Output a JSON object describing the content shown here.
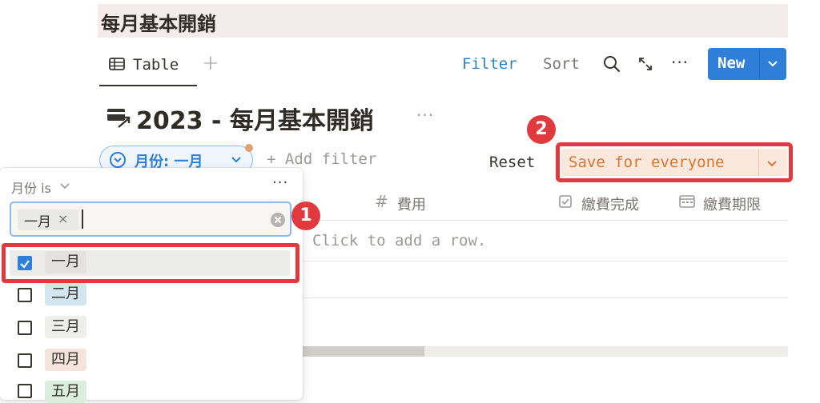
{
  "page": {
    "title": "每月基本開銷"
  },
  "view_tabs": [
    {
      "label": "Table",
      "icon": "table-icon",
      "active": true
    }
  ],
  "toolbar": {
    "add_view": "+",
    "filter": "Filter",
    "sort": "Sort",
    "search_icon": "search-icon",
    "expand_icon": "expand-icon",
    "more": "···",
    "new": "New"
  },
  "database": {
    "title": "2023 - 每月基本開銷",
    "more": "···",
    "icon": "billing-icon"
  },
  "filter_bar": {
    "chip_label": "月份: 一月",
    "add_filter": "Add filter",
    "add_filter_plus": "+",
    "reset": "Reset",
    "save": "Save for everyone"
  },
  "badges": {
    "first": "1",
    "second": "2"
  },
  "table": {
    "columns": [
      {
        "name": "費用",
        "icon": "#"
      },
      {
        "name": "繳費完成",
        "icon": "checkbox-icon"
      },
      {
        "name": "繳費期限",
        "icon": "calendar-icon"
      }
    ],
    "empty_text": "Click to add a row."
  },
  "dropdown": {
    "heading": "月份 is",
    "more": "···",
    "selected_tag": "一月",
    "remove": "×",
    "options": [
      {
        "label": "一月",
        "checked": true,
        "color": "#e3e2e0"
      },
      {
        "label": "二月",
        "checked": false,
        "color": "#d3e5ef"
      },
      {
        "label": "三月",
        "checked": false,
        "color": "#eeeeec"
      },
      {
        "label": "四月",
        "checked": false,
        "color": "#f4e4dc"
      },
      {
        "label": "五月",
        "checked": false,
        "color": "#dbeddb"
      }
    ]
  },
  "colors": {
    "accent": "#2f7fd8",
    "highlight": "#e0393e",
    "save_text": "#d9772e"
  }
}
